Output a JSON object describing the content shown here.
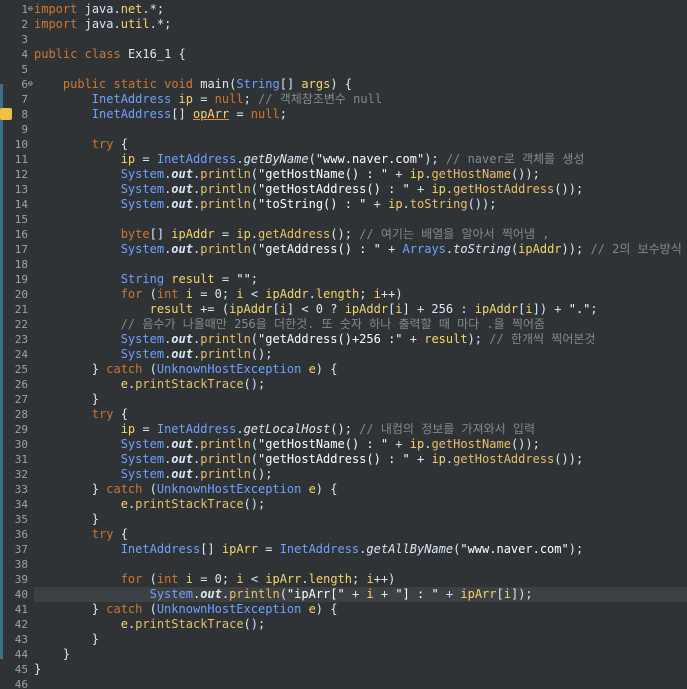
{
  "editor": {
    "lines": [
      {
        "n": "1",
        "text": "import java.net.*;"
      },
      {
        "n": "2",
        "text": "import java.util.*;"
      },
      {
        "n": "3",
        "text": ""
      },
      {
        "n": "4",
        "text": "public class Ex16_1 {"
      },
      {
        "n": "5",
        "text": ""
      },
      {
        "n": "6",
        "text": "    public static void main(String[] args) {"
      },
      {
        "n": "7",
        "text": "        InetAddress ip = null; // 객체참조변수 null"
      },
      {
        "n": "8",
        "text": "        InetAddress[] opArr = null;"
      },
      {
        "n": "9",
        "text": ""
      },
      {
        "n": "10",
        "text": "        try {"
      },
      {
        "n": "11",
        "text": "            ip = InetAddress.getByName(\"www.naver.com\"); // naver로 객체를 생성"
      },
      {
        "n": "12",
        "text": "            System.out.println(\"getHostName() : \" + ip.getHostName());"
      },
      {
        "n": "13",
        "text": "            System.out.println(\"getHostAddress() : \" + ip.getHostAddress());"
      },
      {
        "n": "14",
        "text": "            System.out.println(\"toString() : \" + ip.toString());"
      },
      {
        "n": "15",
        "text": ""
      },
      {
        "n": "16",
        "text": "            byte[] ipAddr = ip.getAddress(); // 여기는 배열을 알아서 찍어냄 ,"
      },
      {
        "n": "17",
        "text": "            System.out.println(\"getAddress() : \" + Arrays.toString(ipAddr)); // 2의 보수방식"
      },
      {
        "n": "18",
        "text": ""
      },
      {
        "n": "19",
        "text": "            String result = \"\";"
      },
      {
        "n": "20",
        "text": "            for (int i = 0; i < ipAddr.length; i++)"
      },
      {
        "n": "21",
        "text": "                result += (ipAddr[i] < 0 ? ipAddr[i] + 256 : ipAddr[i]) + \".\";"
      },
      {
        "n": "22",
        "text": "            // 음수가 나올때만 256을 더한것. 또 숫자 하나 출력할 때 마다 .을 찍어줌"
      },
      {
        "n": "23",
        "text": "            System.out.println(\"getAddress()+256 :\" + result); // 한개씩 찍어본것"
      },
      {
        "n": "24",
        "text": "            System.out.println();"
      },
      {
        "n": "25",
        "text": "        } catch (UnknownHostException e) {"
      },
      {
        "n": "26",
        "text": "            e.printStackTrace();"
      },
      {
        "n": "27",
        "text": "        }"
      },
      {
        "n": "28",
        "text": "        try {"
      },
      {
        "n": "29",
        "text": "            ip = InetAddress.getLocalHost(); // 내컴의 정보를 가져와서 입력"
      },
      {
        "n": "30",
        "text": "            System.out.println(\"getHostName() : \" + ip.getHostName());"
      },
      {
        "n": "31",
        "text": "            System.out.println(\"getHostAddress() : \" + ip.getHostAddress());"
      },
      {
        "n": "32",
        "text": "            System.out.println();"
      },
      {
        "n": "33",
        "text": "        } catch (UnknownHostException e) {"
      },
      {
        "n": "34",
        "text": "            e.printStackTrace();"
      },
      {
        "n": "35",
        "text": "        }"
      },
      {
        "n": "36",
        "text": "        try {"
      },
      {
        "n": "37",
        "text": "            InetAddress[] ipArr = InetAddress.getAllByName(\"www.naver.com\");"
      },
      {
        "n": "38",
        "text": ""
      },
      {
        "n": "39",
        "text": "            for (int i = 0; i < ipArr.length; i++)"
      },
      {
        "n": "40",
        "text": "                System.out.println(\"ipArr[\" + i + \"] : \" + ipArr[i]);"
      },
      {
        "n": "41",
        "text": "        } catch (UnknownHostException e) {"
      },
      {
        "n": "42",
        "text": "            e.printStackTrace();"
      },
      {
        "n": "43",
        "text": "        }"
      },
      {
        "n": "44",
        "text": "    }"
      },
      {
        "n": "45",
        "text": "}"
      },
      {
        "n": "46",
        "text": ""
      }
    ],
    "current_line": "40",
    "warning_line": "8",
    "fold_lines": [
      "1",
      "6"
    ]
  }
}
